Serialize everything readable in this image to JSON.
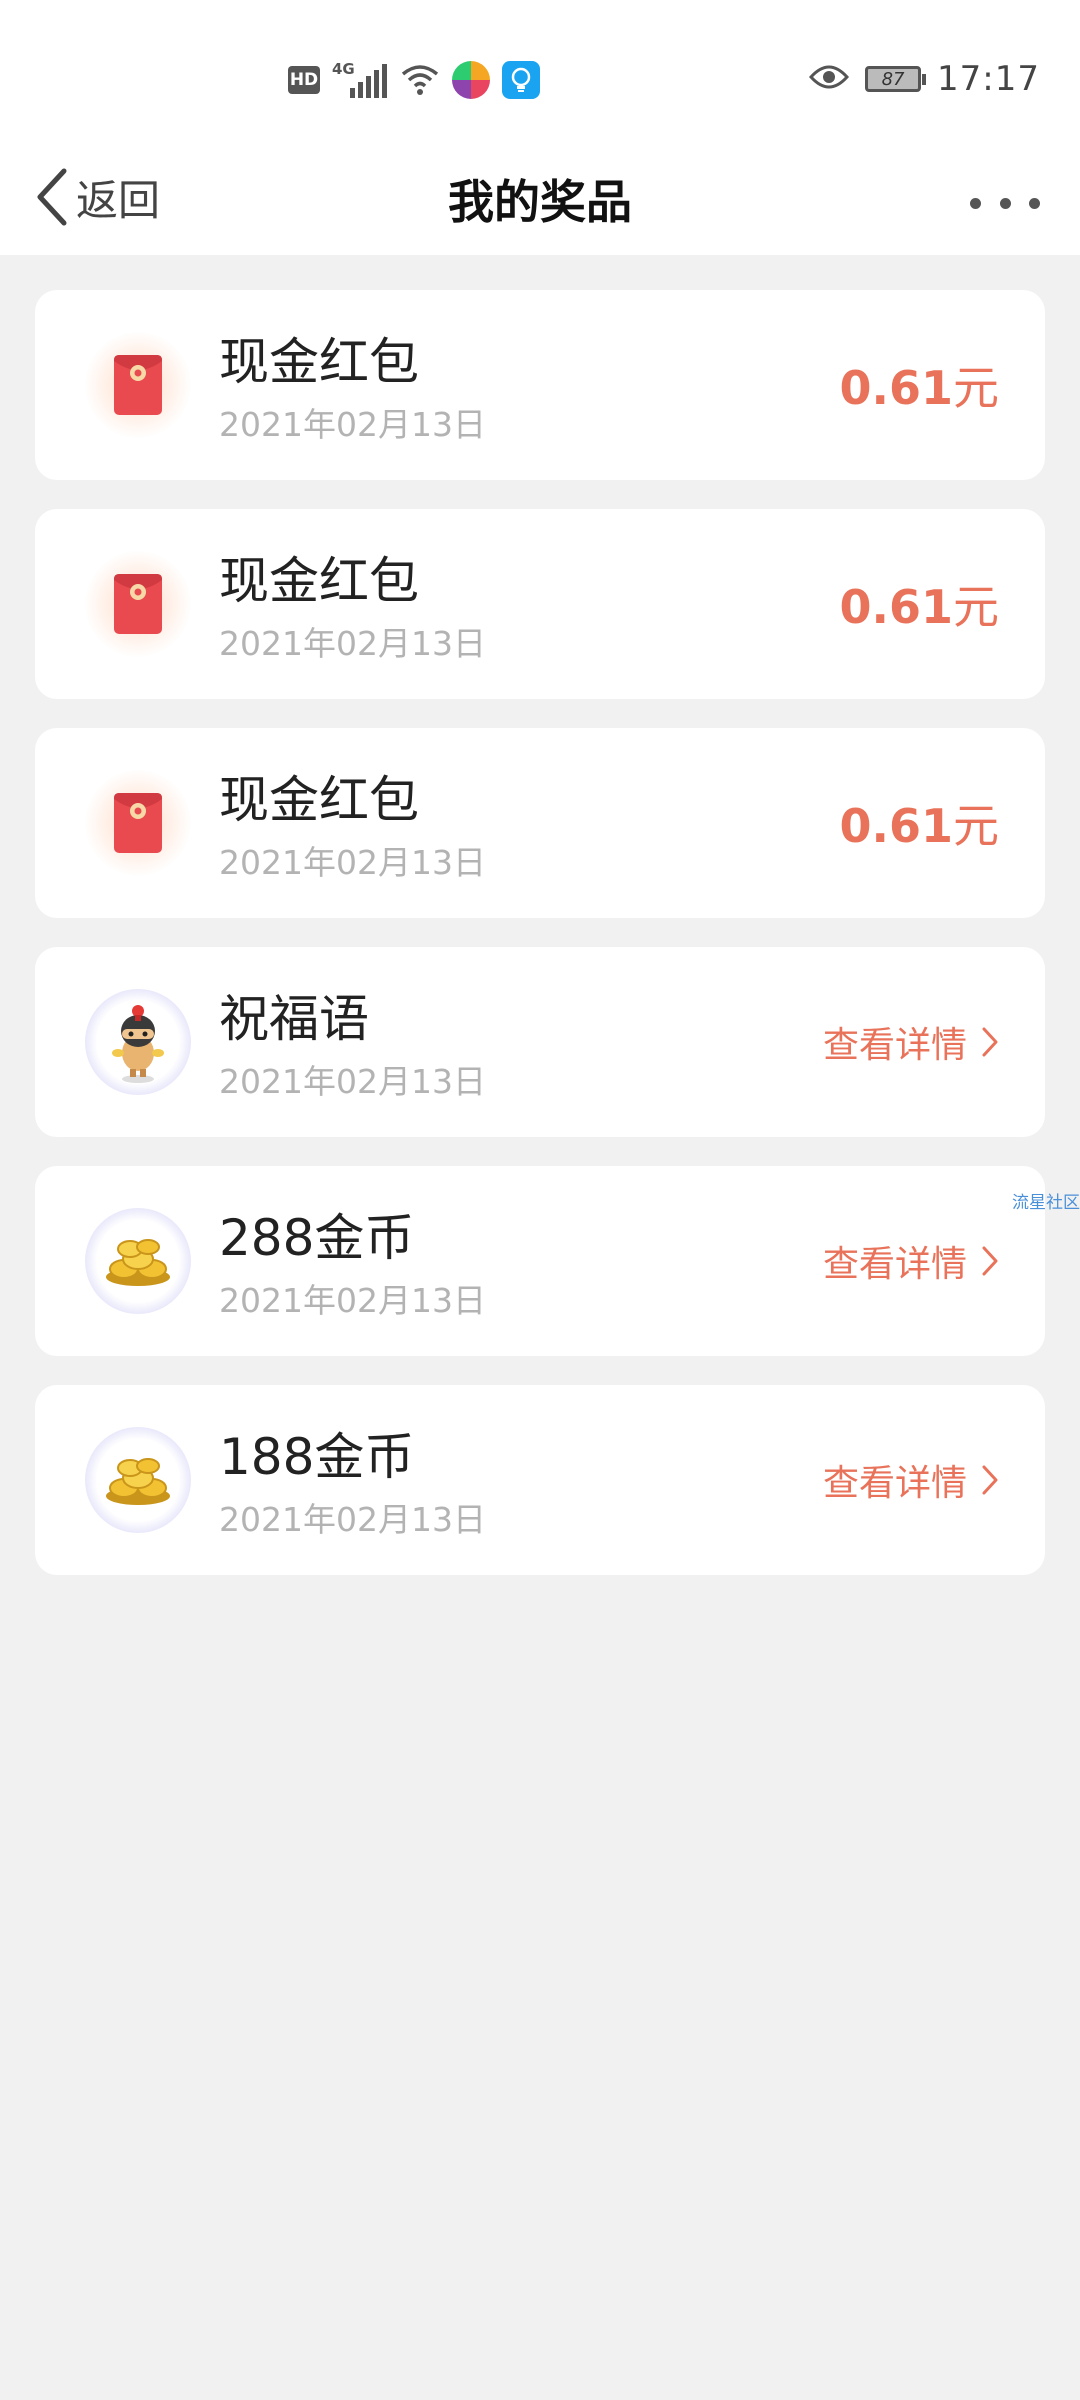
{
  "status_bar": {
    "hd": "HD",
    "network": "4G",
    "battery": "87",
    "time": "17:17"
  },
  "nav": {
    "back_label": "返回",
    "title": "我的奖品"
  },
  "prizes": [
    {
      "title": "现金红包",
      "date": "2021年02月13日",
      "amount": "0.61",
      "unit": "元",
      "icon": "red-packet-icon"
    },
    {
      "title": "现金红包",
      "date": "2021年02月13日",
      "amount": "0.61",
      "unit": "元",
      "icon": "red-packet-icon"
    },
    {
      "title": "现金红包",
      "date": "2021年02月13日",
      "amount": "0.61",
      "unit": "元",
      "icon": "red-packet-icon"
    },
    {
      "title": "祝福语",
      "date": "2021年02月13日",
      "link": "查看详情",
      "icon": "mascot-icon"
    },
    {
      "title": "288金币",
      "date": "2021年02月13日",
      "link": "查看详情",
      "icon": "gold-coins-icon"
    },
    {
      "title": "188金币",
      "date": "2021年02月13日",
      "link": "查看详情",
      "icon": "gold-coins-icon"
    }
  ],
  "watermark": "流星社区",
  "colors": {
    "accent": "#e8735a",
    "background": "#f1f1f1",
    "card": "#ffffff",
    "date_text": "#b3b3b3"
  }
}
